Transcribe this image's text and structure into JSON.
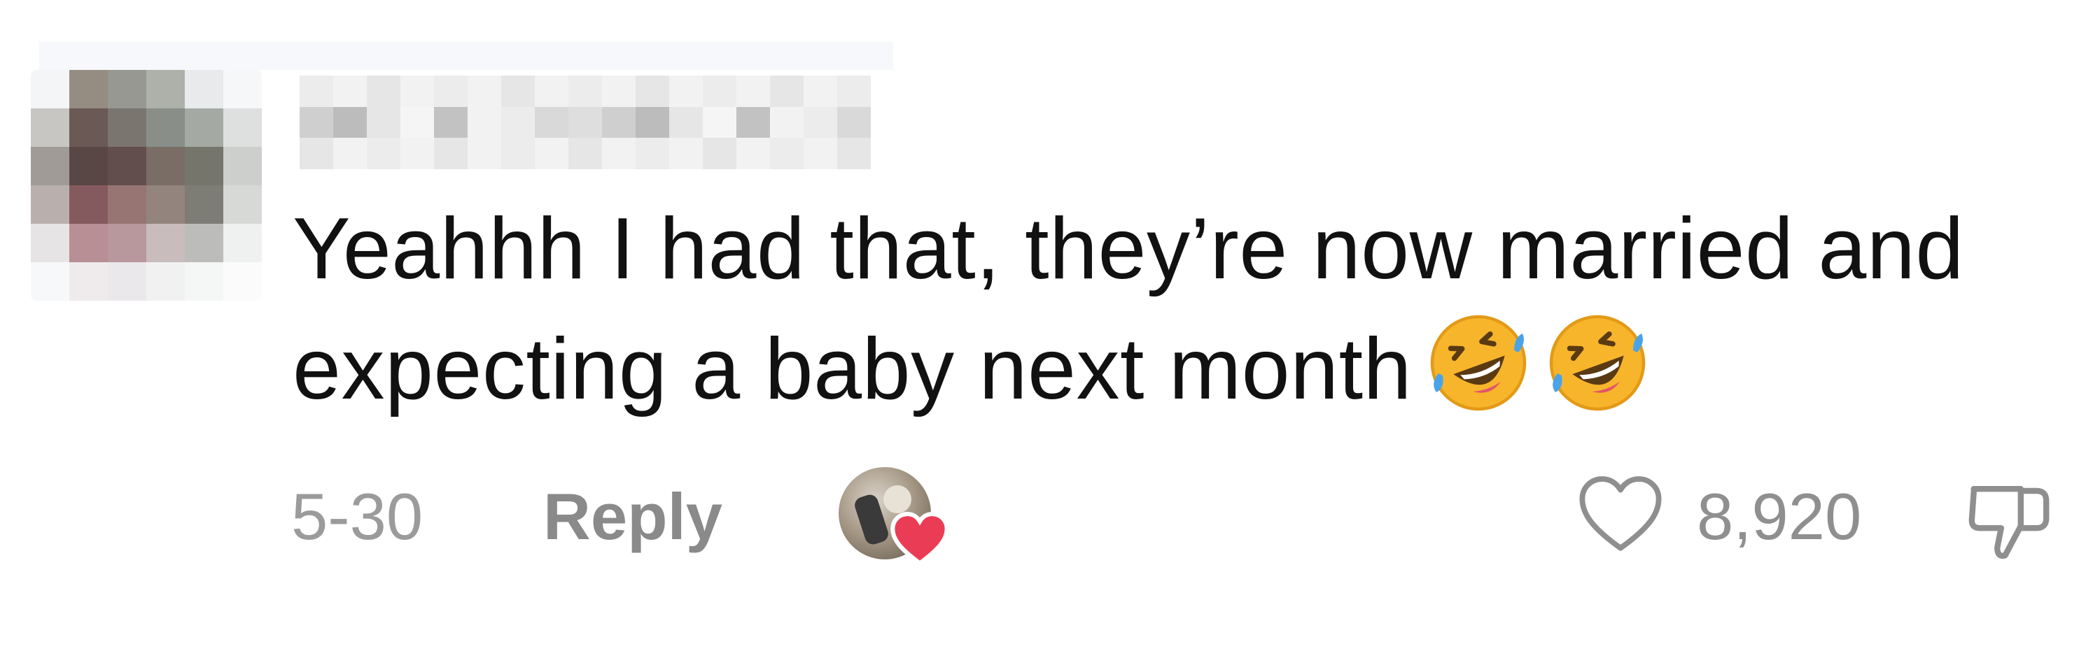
{
  "comment": {
    "avatar_icon": "pixelated-avatar",
    "username_icon": "pixelated-username",
    "text_line1": "Yeahhh I had that, they’re now married and",
    "text_line2": "expecting a baby next month",
    "emojis": [
      "rolling-on-floor-laughing-emoji",
      "rolling-on-floor-laughing-emoji"
    ],
    "date": "5-30",
    "reply_label": "Reply",
    "creator_liked_icon": "creator-liked-avatar",
    "like_icon": "heart-outline-icon",
    "like_count": "8,920",
    "dislike_icon": "thumbs-down-icon",
    "colors": {
      "text": "#111111",
      "meta": "#9b9b9b",
      "heart_badge": "#ea3d55",
      "emoji_face": "#f7b52c"
    }
  }
}
